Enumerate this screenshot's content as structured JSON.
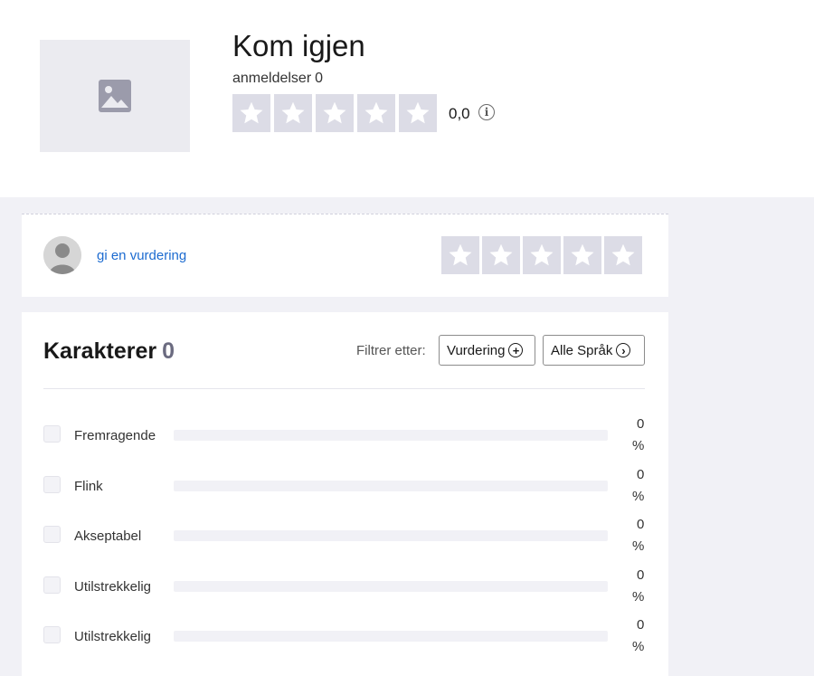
{
  "business": {
    "name": "Kom igjen",
    "review_label": "anmeldelser",
    "review_count": "0",
    "score": "0,0",
    "header_stars": 5,
    "icons": {
      "logo": "image-placeholder-icon",
      "info": "info-circle-icon",
      "star": "star-icon"
    }
  },
  "write_review": {
    "link_text": "gi en vurdering",
    "stars": 5,
    "avatar_icon": "user-avatar-icon"
  },
  "ratings": {
    "title": "Karakterer",
    "count": "0",
    "filter_label": "Filtrer etter:",
    "filter_rating_label": "Vurdering",
    "filter_language_label": "Alle Språk",
    "rows": [
      {
        "label": "Fremragende",
        "percent": 0,
        "percent_text": "0",
        "sign": "%"
      },
      {
        "label": "Flink",
        "percent": 0,
        "percent_text": "0",
        "sign": "%"
      },
      {
        "label": "Akseptabel",
        "percent": 0,
        "percent_text": "0",
        "sign": "%"
      },
      {
        "label": "Utilstrekkelig",
        "percent": 0,
        "percent_text": "0",
        "sign": "%"
      },
      {
        "label": "Utilstrekkelig",
        "percent": 0,
        "percent_text": "0",
        "sign": "%"
      }
    ]
  },
  "colors": {
    "star_empty_bg": "#dcdce6",
    "link": "#1c6bd0",
    "bar_fill": "#00b67a"
  }
}
